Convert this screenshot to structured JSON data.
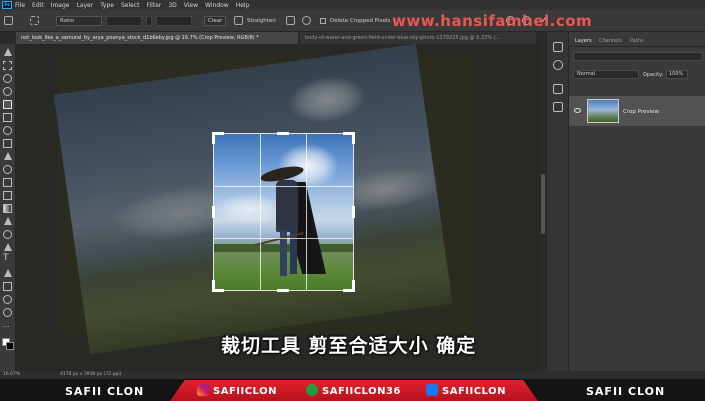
{
  "menu": {
    "items": [
      "File",
      "Edit",
      "Image",
      "Layer",
      "Type",
      "Select",
      "Filter",
      "3D",
      "View",
      "Window",
      "Help"
    ]
  },
  "options": {
    "ratio_label": "Ratio",
    "clear_label": "Clear",
    "straighten_label": "Straighten",
    "delete_cropped_label": "Delete Cropped Pixels",
    "watermark": "www.hansifamhel.com"
  },
  "tabs": [
    {
      "label": "not_look_like_a_samurai_by_arya_poonya_stock_d1b6eby.jpg @ 16.7% (Crop Preview, RGB/8) *"
    },
    {
      "label": "body-of-water-and-green-field-under-blue-sky-photo-1179225.jpg @ 8.33% (..."
    }
  ],
  "layers_panel": {
    "tabs": [
      "Layers",
      "Channels",
      "Paths"
    ],
    "blend_mode": "Normal",
    "opacity_label": "Opacity:",
    "opacity_value": "100%",
    "layer_name": "Crop Preview"
  },
  "subtitle": "裁切工具 剪至合适大小 确定",
  "status": {
    "zoom": "16.67%",
    "doc_size": "4176 px x 3936 px (72 ppi)"
  },
  "banner": {
    "left_brand": "SAFII CLON",
    "instagram_handle": "SAFIICLON",
    "xbox_handle": "SAFIICLON36",
    "facebook_handle": "SAFIICLON",
    "right_brand": "SAFII CLON",
    "colors": {
      "accent": "#e4202e",
      "background": "#141414"
    }
  },
  "icons": [
    "photoshop-logo",
    "crop-icon",
    "grid-overlay-icon",
    "settings-gear-icon",
    "reset-icon",
    "cancel-icon",
    "commit-check-icon",
    "eye-icon",
    "instagram-icon",
    "xbox-icon",
    "facebook-icon"
  ]
}
